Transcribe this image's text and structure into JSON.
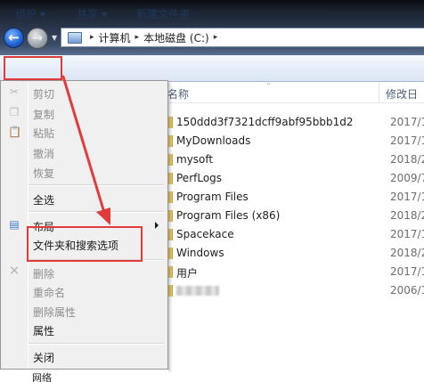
{
  "address_bar": {
    "crumbs": [
      "计算机",
      "本地磁盘 (C:)"
    ],
    "separator": "▸"
  },
  "toolbar": {
    "organize": "组织",
    "share": "共享",
    "new_folder": "新建文件夹",
    "dropdown_arrow": "▼"
  },
  "columns": {
    "name": "名称",
    "date": "修改日"
  },
  "files": [
    {
      "name": "150ddd3f7321dcff9abf95bbb1d2",
      "date": "2017/1"
    },
    {
      "name": "MyDownloads",
      "date": "2017/1"
    },
    {
      "name": "mysoft",
      "date": "2018/2"
    },
    {
      "name": "PerfLogs",
      "date": "2009/7"
    },
    {
      "name": "Program Files",
      "date": "2017/1"
    },
    {
      "name": "Program Files (x86)",
      "date": "2018/2"
    },
    {
      "name": "Spacekace",
      "date": "2017/1"
    },
    {
      "name": "Windows",
      "date": "2018/2"
    },
    {
      "name": "用户",
      "date": "2017/1"
    },
    {
      "name": "",
      "date": "2006/1"
    }
  ],
  "menu": {
    "cut": "剪切",
    "copy": "复制",
    "paste": "粘贴",
    "undo": "撤消",
    "redo": "恢复",
    "select_all": "全选",
    "layout": "布局",
    "folder_options": "文件夹和搜索选项",
    "delete": "删除",
    "rename": "重命名",
    "remove_properties": "删除属性",
    "properties": "属性",
    "close": "关闭"
  },
  "bottom_item": "网络",
  "colors": {
    "highlight": "#e23b3b",
    "disabled_text": "#8d8d8d"
  }
}
